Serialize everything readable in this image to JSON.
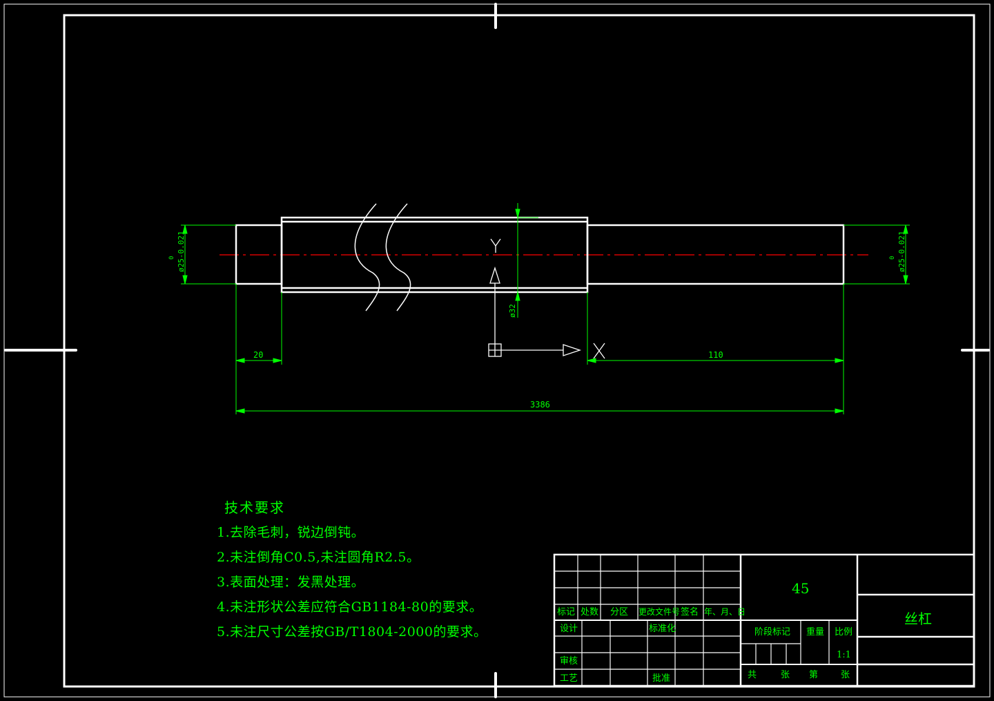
{
  "drawing": {
    "dimensions": {
      "dia_left": "ø25-0.021",
      "dia_right": "ø25-0.021",
      "dia_left_upper": "0",
      "dia_right_upper": "0",
      "dia_center": "ø32",
      "len_left": "20",
      "len_right": "110",
      "len_total": "3386"
    },
    "ucs": {
      "x_label": "X",
      "y_label": "Y"
    }
  },
  "tech_requirements": {
    "title": "技术要求",
    "items": [
      "1.去除毛刺，锐边倒钝。",
      "2.未注倒角C0.5,未注圆角R2.5。",
      "3.表面处理：发黑处理。",
      "4.未注形状公差应符合GB1184-80的要求。",
      "5.未注尺寸公差按GB/T1804-2000的要求。"
    ]
  },
  "title_block": {
    "material": "45",
    "part_name": "丝杠",
    "headers": {
      "mark": "标记",
      "count": "处数",
      "zone": "分区",
      "doc_no": "更改文件号",
      "signature": "签名",
      "date": "年、月、日"
    },
    "roles": {
      "design": "设计",
      "standardize": "标准化",
      "review": "审核",
      "process": "工艺",
      "approve": "批准"
    },
    "stage_mark": "阶段标记",
    "weight": "重量",
    "scale_label": "比例",
    "scale_value": "1:1",
    "sheet_total": "共",
    "sheet_unit1": "张",
    "sheet_no": "第",
    "sheet_unit2": "张"
  },
  "colors": {
    "outline": "#ffffff",
    "dimension": "#00ff00",
    "centerline": "#ff0000",
    "text": "#00ff00"
  }
}
